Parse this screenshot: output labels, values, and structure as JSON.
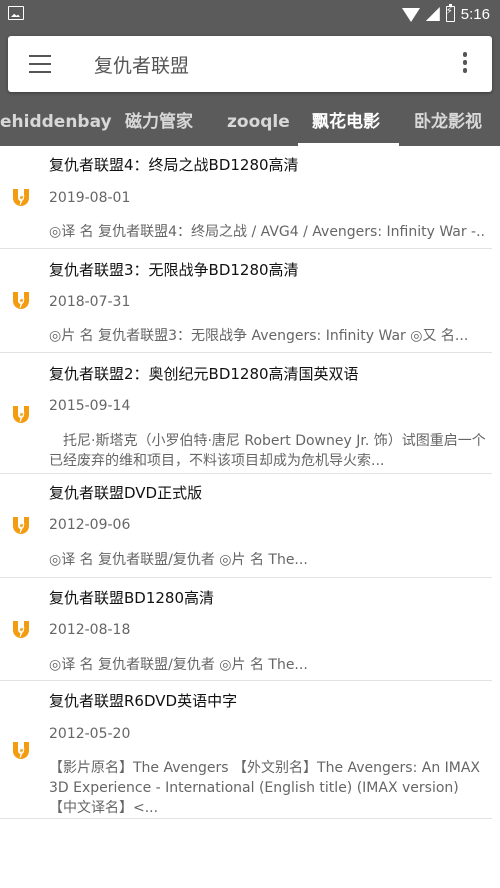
{
  "status_bar": {
    "time": "5:16"
  },
  "search": {
    "query": "复仇者联盟"
  },
  "tabs": [
    {
      "label": "ehiddenbay",
      "active": false
    },
    {
      "label": "磁力管家",
      "active": false
    },
    {
      "label": "zooqle",
      "active": false
    },
    {
      "label": "飘花电影",
      "active": true
    },
    {
      "label": "卧龙影视",
      "active": false
    }
  ],
  "results": [
    {
      "title": "复仇者联盟4：终局之战BD1280高清",
      "date": "2019-08-01",
      "desc": "◎译 名 复仇者联盟4：终局之战 / AVG4 / Avengers: Infinity War -..."
    },
    {
      "title": "复仇者联盟3：无限战争BD1280高清",
      "date": "2018-07-31",
      "desc": "◎片 名 复仇者联盟3：无限战争 Avengers: Infinity War ◎又 名..."
    },
    {
      "title": "复仇者联盟2：奥创纪元BD1280高清国英双语",
      "date": "2015-09-14",
      "desc": "　托尼·斯塔克（小罗伯特·唐尼 Robert Downey Jr. 饰）试图重启一个已经废弃的维和项目，不料该项目却成为危机导火索..."
    },
    {
      "title": "复仇者联盟DVD正式版",
      "date": "2012-09-06",
      "desc": "◎译 名 复仇者联盟/复仇者 ◎片 名 The..."
    },
    {
      "title": "复仇者联盟BD1280高清",
      "date": "2012-08-18",
      "desc": "◎译 名 复仇者联盟/复仇者 ◎片 名 The..."
    },
    {
      "title": "复仇者联盟R6DVD英语中字",
      "date": "2012-05-20",
      "desc": "【影片原名】The Avengers 【外文别名】The Avengers: An IMAX 3D Experience - International (English title) (IMAX version) 【中文译名】<..."
    }
  ],
  "colors": {
    "header": "#5b5b5b",
    "icon": "#f39c12"
  }
}
